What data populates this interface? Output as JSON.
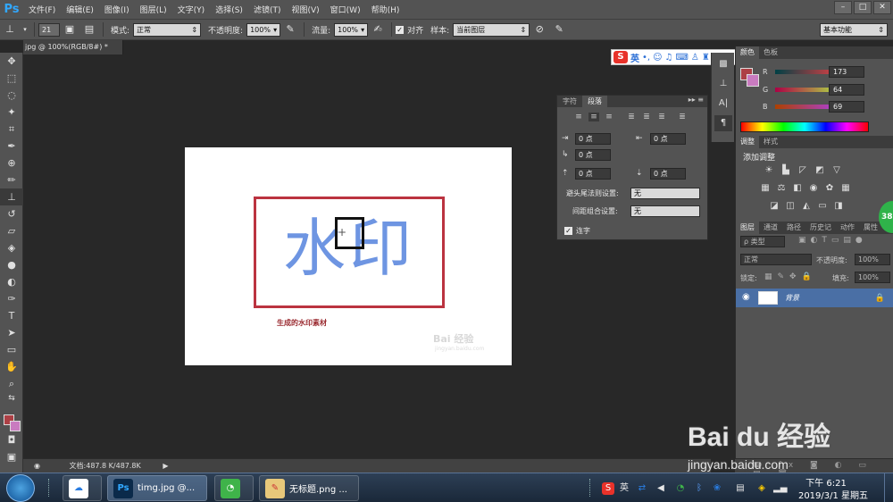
{
  "menubar": {
    "logo": "Ps",
    "items": [
      "文件(F)",
      "编辑(E)",
      "图像(I)",
      "图层(L)",
      "文字(Y)",
      "选择(S)",
      "滤镜(T)",
      "视图(V)",
      "窗口(W)",
      "帮助(H)"
    ],
    "win_min": "–",
    "win_max": "□",
    "win_close": "✕"
  },
  "options": {
    "brush_size": "21",
    "mode_label": "模式:",
    "mode_value": "正常",
    "opacity_label": "不透明度:",
    "opacity_value": "100%",
    "flow_label": "流量:",
    "flow_value": "100%",
    "align_label": "对齐",
    "sample_label": "样本:",
    "sample_value": "当前图层",
    "workspace": "基本功能"
  },
  "doc_tab": "jpg @ 100%(RGB/8#) *",
  "canvas": {
    "watermark_text": "水印",
    "caption": "生成的水印素材",
    "faint_logo": "Bai 经验",
    "faint_url": "jingyan.baidu.com"
  },
  "ime": {
    "lang": "英",
    "logo": "S"
  },
  "paragraph_panel": {
    "tab_char": "字符",
    "tab_para": "段落",
    "indent_left": "0 点",
    "indent_right": "0 点",
    "indent_first": "0 点",
    "space_before": "0 点",
    "space_after": "0 点",
    "avoid_label": "避头尾法则设置:",
    "avoid_value": "无",
    "spacing_label": "间距组合设置:",
    "spacing_value": "无",
    "hyphen_label": "连字"
  },
  "color_panel": {
    "tab_color": "颜色",
    "tab_swatch": "色板",
    "r_label": "R",
    "g_label": "G",
    "b_label": "B",
    "r": "173",
    "g": "64",
    "b": "69",
    "fg_color": "#ad4045"
  },
  "adjust_panel": {
    "tab_adjust": "调整",
    "tab_style": "样式",
    "title": "添加调整"
  },
  "layers_panel": {
    "tabs": [
      "图层",
      "通道",
      "路径",
      "历史记",
      "动作",
      "属性"
    ],
    "filter_label": "ρ 类型",
    "blend": "正常",
    "opacity_label": "不透明度:",
    "opacity_value": "100%",
    "lock_label": "锁定:",
    "fill_label": "填充:",
    "fill_value": "100%",
    "layer_name": "背景"
  },
  "status": {
    "doc_size": "文档:487.8 K/487.8K"
  },
  "taskbar": {
    "ps_label": "timg.jpg @...",
    "paint_label": "无标题.png ...",
    "time": "下午 6:21",
    "date": "2019/3/1 星期五"
  },
  "overlay": {
    "baidu_brand": "Bai du 经验",
    "baidu_url": "jingyan.baidu.com",
    "badge": "38"
  }
}
